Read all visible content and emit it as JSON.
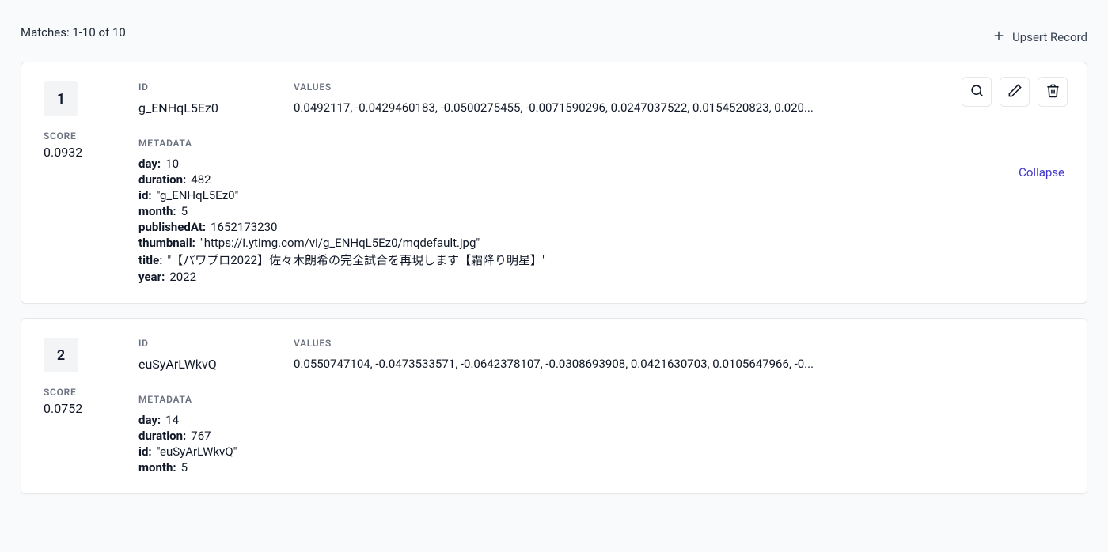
{
  "header": {
    "matches_text": "Matches: 1-10 of 10",
    "upsert_label": "Upsert Record"
  },
  "labels": {
    "id": "ID",
    "values": "VALUES",
    "score": "SCORE",
    "metadata": "METADATA",
    "collapse": "Collapse"
  },
  "records": [
    {
      "rank": "1",
      "score": "0.0932",
      "id": "g_ENHqL5Ez0",
      "values": "0.0492117, -0.0429460183, -0.0500275455, -0.0071590296, 0.0247037522, 0.0154520823, 0.020...",
      "collapse_visible": true,
      "metadata": [
        {
          "key": "day:",
          "val": "10"
        },
        {
          "key": "duration:",
          "val": "482"
        },
        {
          "key": "id:",
          "val": "\"g_ENHqL5Ez0\""
        },
        {
          "key": "month:",
          "val": "5"
        },
        {
          "key": "publishedAt:",
          "val": "1652173230"
        },
        {
          "key": "thumbnail:",
          "val": "\"https://i.ytimg.com/vi/g_ENHqL5Ez0/mqdefault.jpg\""
        },
        {
          "key": "title:",
          "val": "\"【パワプロ2022】佐々木朗希の完全試合を再現します【霜降り明星】\""
        },
        {
          "key": "year:",
          "val": "2022"
        }
      ]
    },
    {
      "rank": "2",
      "score": "0.0752",
      "id": "euSyArLWkvQ",
      "values": "0.0550747104, -0.0473533571, -0.0642378107, -0.0308693908, 0.0421630703, 0.0105647966, -0...",
      "collapse_visible": false,
      "metadata": [
        {
          "key": "day:",
          "val": "14"
        },
        {
          "key": "duration:",
          "val": "767"
        },
        {
          "key": "id:",
          "val": "\"euSyArLWkvQ\""
        },
        {
          "key": "month:",
          "val": "5"
        }
      ]
    }
  ]
}
